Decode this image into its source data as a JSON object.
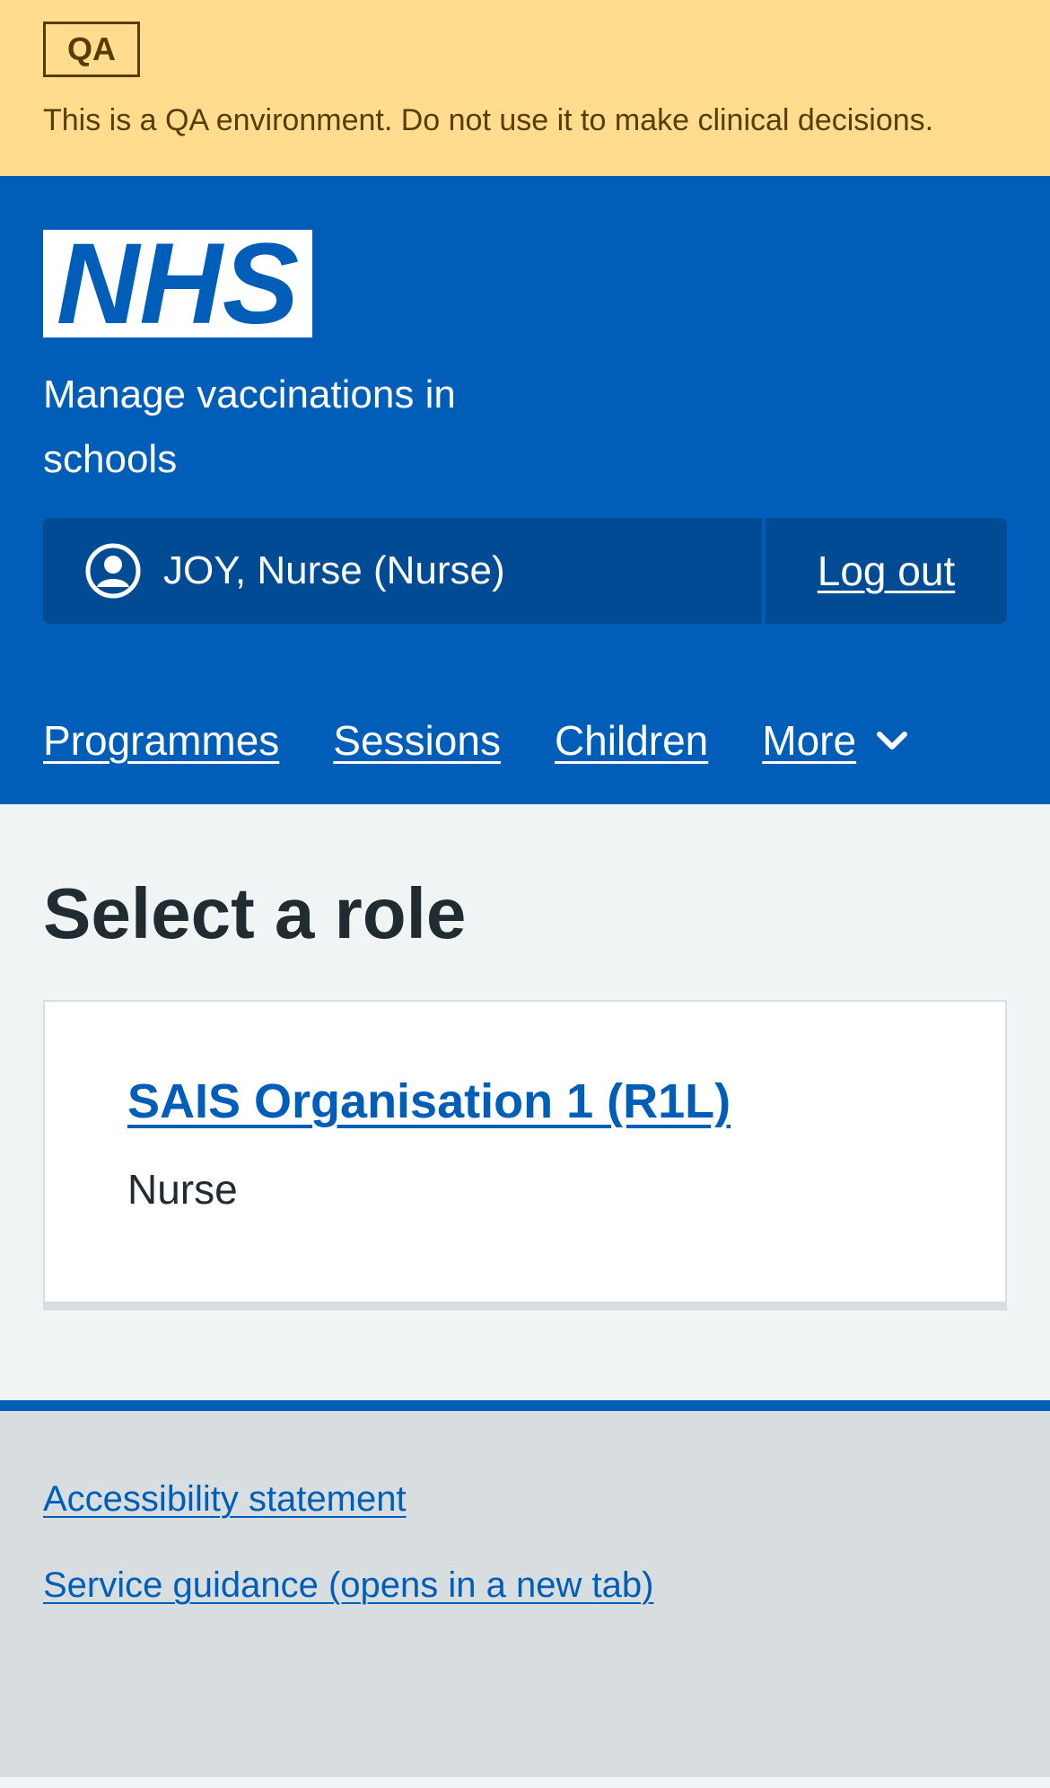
{
  "qa_banner": {
    "tag": "QA",
    "message": "This is a QA environment. Do not use it to make clinical decisions."
  },
  "header": {
    "logo_text": "NHS",
    "service_name": "Manage vaccinations in schools",
    "account": {
      "user_label": "JOY, Nurse (Nurse)",
      "logout_label": "Log out"
    },
    "nav": {
      "items": [
        {
          "label": "Programmes"
        },
        {
          "label": "Sessions"
        },
        {
          "label": "Children"
        },
        {
          "label": "More"
        }
      ]
    }
  },
  "main": {
    "title": "Select a role",
    "card": {
      "organisation_link": "SAIS Organisation 1 (R1L)",
      "role": "Nurse"
    }
  },
  "footer": {
    "links": [
      {
        "label": "Accessibility statement"
      },
      {
        "label": "Service guidance (opens in a new tab)"
      }
    ]
  },
  "colors": {
    "nhs_blue": "#005eb8",
    "qa_banner_bg": "#ffdc8e",
    "qa_text": "#593c00",
    "page_bg": "#f0f4f5",
    "footer_bg": "#d8dde0"
  },
  "icons": {
    "user": "user-circle-icon",
    "more_chevron": "chevron-down-icon"
  }
}
